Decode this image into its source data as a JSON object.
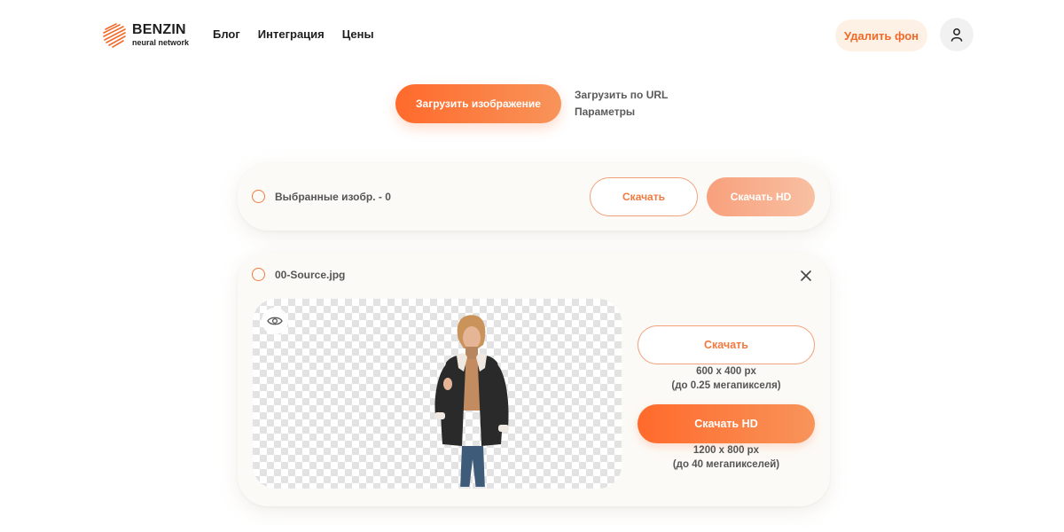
{
  "header": {
    "logo": {
      "name": "BENZIN",
      "sub": "neural network"
    },
    "nav": [
      "Блог",
      "Интеграция",
      "Цены"
    ],
    "remove_bg_label": "Удалить фон",
    "user_icon": "user-icon"
  },
  "upload": {
    "primary_label": "Загрузить изображение",
    "url_label": "Загрузить по URL",
    "params_label": "Параметры"
  },
  "summary": {
    "selected_label": "Выбранные изобр. - 0",
    "download_label": "Скачать",
    "download_hd_label": "Скачать HD"
  },
  "file": {
    "name": "00-Source.jpg",
    "download_label": "Скачать",
    "download_size": "600 x 400 px",
    "download_mp": "(до 0.25 мегапикселя)",
    "download_hd_label": "Скачать HD",
    "download_hd_size": "1200 x 800 px",
    "download_hd_mp": "(до 40 мегапикселей)"
  },
  "colors": {
    "accent": "#ff6a2b",
    "accent_soft": "#fdf0e4",
    "card_bg": "#fcfaf6"
  }
}
